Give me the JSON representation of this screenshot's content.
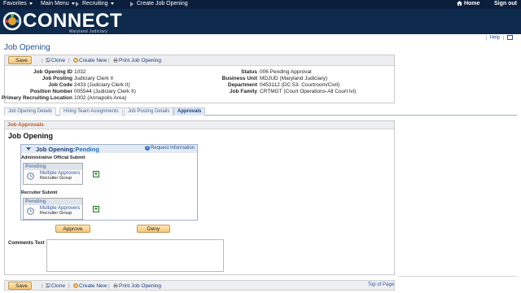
{
  "topnav": {
    "favorites": "Favorites",
    "main_menu": "Main Menu",
    "recruiting": "Recruiting",
    "crumb_current": "Create Job Opening",
    "home": "Home",
    "sign_out": "Sign out"
  },
  "brand": {
    "logo_text": "CONNECT",
    "logo_sub": "Maryland Judiciary"
  },
  "helpbar": {
    "help": "Help"
  },
  "page": {
    "title": "Job Opening"
  },
  "toolbar": {
    "save": "Save",
    "clone": "Clone",
    "create_new": "Create New",
    "print": "Print Job Opening"
  },
  "fields": {
    "job_opening_id_label": "Job Opening ID",
    "job_opening_id": "1032",
    "job_posting_label": "Job Posting",
    "job_posting": "Judiciary Clerk II",
    "job_code_label": "Job Code",
    "job_code": "2433 (Judiciary Clerk II)",
    "position_number_label": "Position Number",
    "position_number": "005544 (Judiciary Clerk II)",
    "primary_location_label": "Primary Recruiting Location",
    "primary_location": "1002 (Annapolis Area)",
    "status_label": "Status",
    "status": "006 Pending Approval",
    "business_unit_label": "Business Unit",
    "business_unit": "MDJUD (Maryland Judiciary)",
    "department_label": "Department",
    "department": "0453112 (DC 53- Courtroom/Civil)",
    "job_family_label": "Job Family",
    "job_family": "CRTMGT (Court Operations-All Court lvl)"
  },
  "tabs": [
    {
      "label": "Job Opening Details"
    },
    {
      "label": "Hiring Team Assignments"
    },
    {
      "label": "Job Posting Details"
    },
    {
      "label": "Approvals"
    }
  ],
  "approvals": {
    "section_header": "Job Approvals",
    "big_title": "Job Opening",
    "workflow_title": "Job Opening:",
    "workflow_status": "Pending",
    "request_info": "Request Information",
    "steps": [
      {
        "label": "Administrative Official Submit",
        "status": "Pending",
        "approver": "Multiple Approvers",
        "group": "Recruiter Group"
      },
      {
        "label": "Recruiter Submit",
        "status": "Pending",
        "approver": "Multiple Approvers",
        "group": "Recruiter Group"
      }
    ],
    "approve": "Approve",
    "deny": "Deny",
    "comments_label": "Comments Text"
  },
  "bottom": {
    "top_of_page": "Top of Page"
  },
  "colors": {
    "nav_bg": "#0b1f3d",
    "banner_bg": "#0e2a4d",
    "section_header_text": "#b85a23",
    "link": "#2a55a6",
    "button_bg": "#f4c67a"
  }
}
